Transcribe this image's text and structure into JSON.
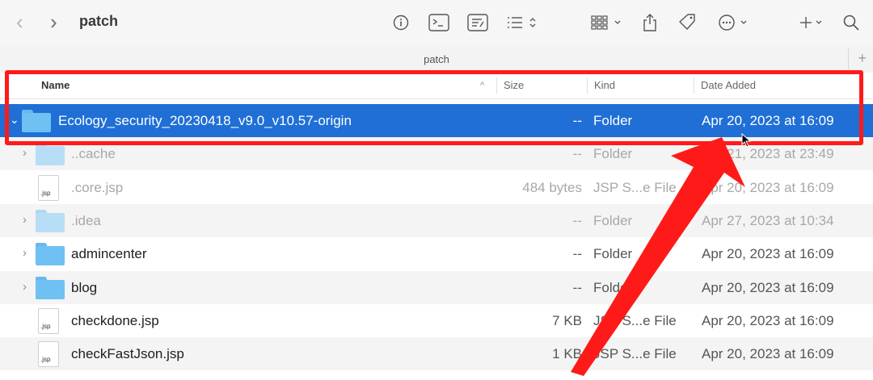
{
  "window": {
    "title": "patch",
    "path_title": "patch"
  },
  "toolbar": {
    "back": "‹",
    "forward": "›",
    "new_tab": "+"
  },
  "columns": {
    "name": "Name",
    "size": "Size",
    "kind": "Kind",
    "date_added": "Date Added"
  },
  "rows": [
    {
      "name": "Ecology_security_20230418_v9.0_v10.57-origin",
      "size": "--",
      "kind": "Folder",
      "date": "Apr 20, 2023 at 16:09",
      "type": "folder",
      "selected": true
    },
    {
      "name": "..cache",
      "size": "--",
      "kind": "Folder",
      "date": "Apr 21, 2023 at 23:49",
      "type": "folder",
      "dim": true
    },
    {
      "name": ".core.jsp",
      "size": "484 bytes",
      "kind": "JSP S...e File",
      "date": "Apr 20, 2023 at 16:09",
      "type": "file",
      "dim": true
    },
    {
      "name": ".idea",
      "size": "--",
      "kind": "Folder",
      "date": "Apr 27, 2023 at 10:34",
      "type": "folder",
      "dim": true
    },
    {
      "name": "admincenter",
      "size": "--",
      "kind": "Folder",
      "date": "Apr 20, 2023 at 16:09",
      "type": "folder"
    },
    {
      "name": "blog",
      "size": "--",
      "kind": "Folder",
      "date": "Apr 20, 2023 at 16:09",
      "type": "folder"
    },
    {
      "name": "checkdone.jsp",
      "size": "7 KB",
      "kind": "JSP S...e File",
      "date": "Apr 20, 2023 at 16:09",
      "type": "file"
    },
    {
      "name": "checkFastJson.jsp",
      "size": "1 KB",
      "kind": "JSP S...e File",
      "date": "Apr 20, 2023 at 16:09",
      "type": "file"
    }
  ],
  "file_ext_label": ".jsp",
  "annotation": {
    "color": "#ff1a1a"
  },
  "selection_color": "#1f6fd6"
}
